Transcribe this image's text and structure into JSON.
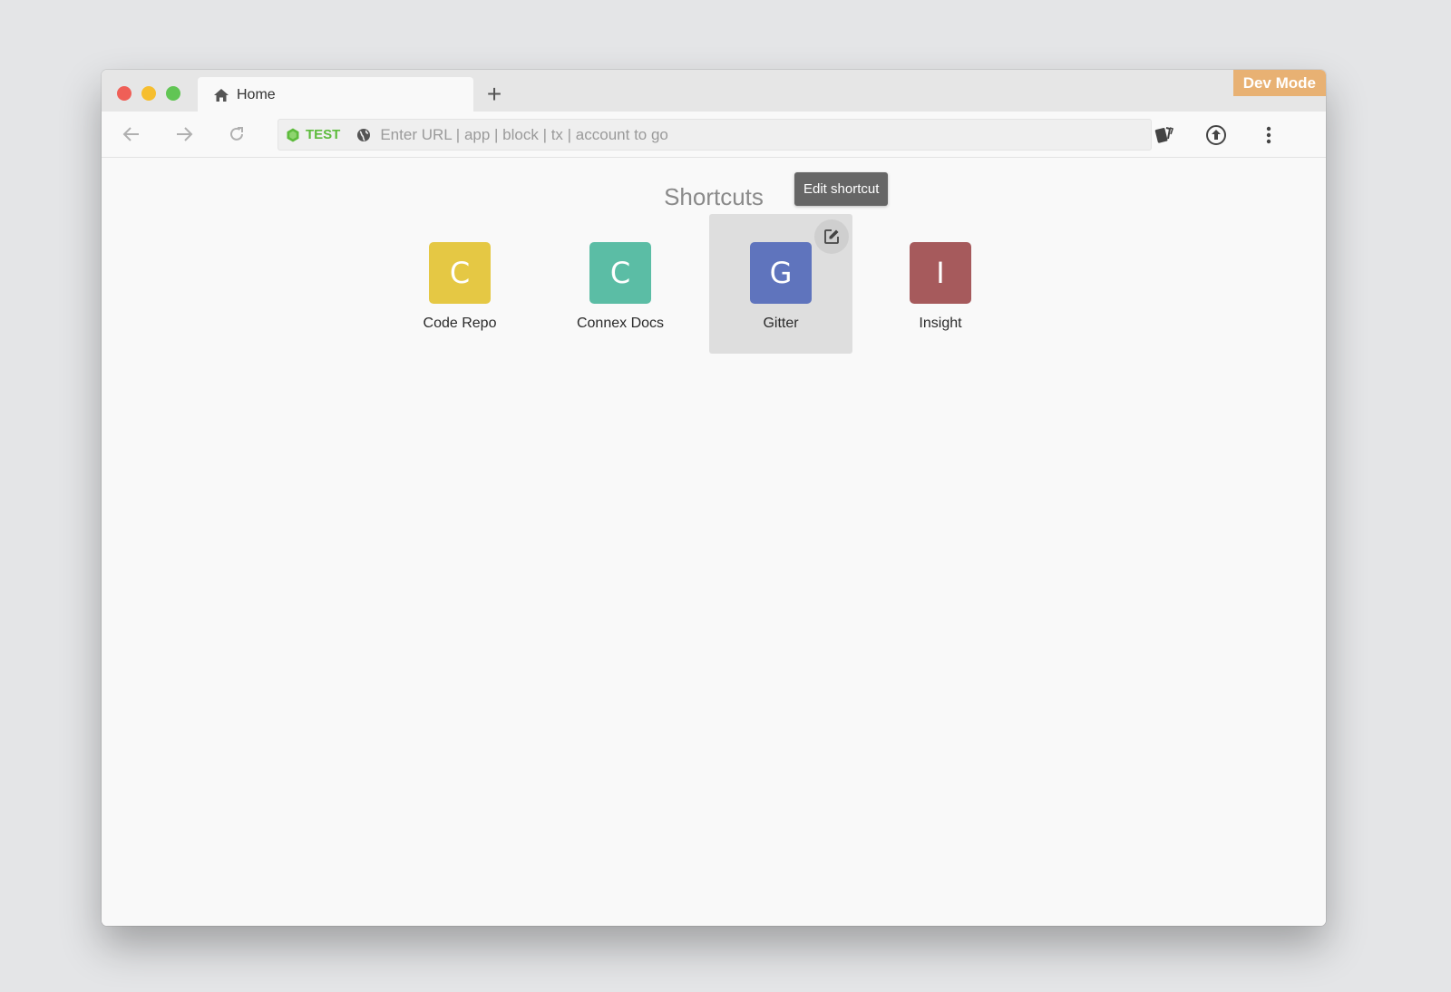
{
  "window": {
    "tab": {
      "label": "Home",
      "icon": "home-icon"
    },
    "new_tab_label": "+",
    "dev_mode_label": "Dev Mode"
  },
  "toolbar": {
    "network_label": "TEST",
    "network_color": "#5dbb3c",
    "url_placeholder": "Enter URL | app | block | tx | account to go",
    "url_value": ""
  },
  "content": {
    "title": "Shortcuts",
    "tooltip": "Edit shortcut",
    "shortcuts": [
      {
        "letter": "C",
        "label": "Code Repo",
        "color": "#e5c844"
      },
      {
        "letter": "C",
        "label": "Connex Docs",
        "color": "#5bbda5"
      },
      {
        "letter": "G",
        "label": "Gitter",
        "color": "#5f74bd"
      },
      {
        "letter": "I",
        "label": "Insight",
        "color": "#a65a5c"
      }
    ]
  },
  "colors": {
    "dev_mode": "#e8b173",
    "background": "#e4e5e7"
  }
}
